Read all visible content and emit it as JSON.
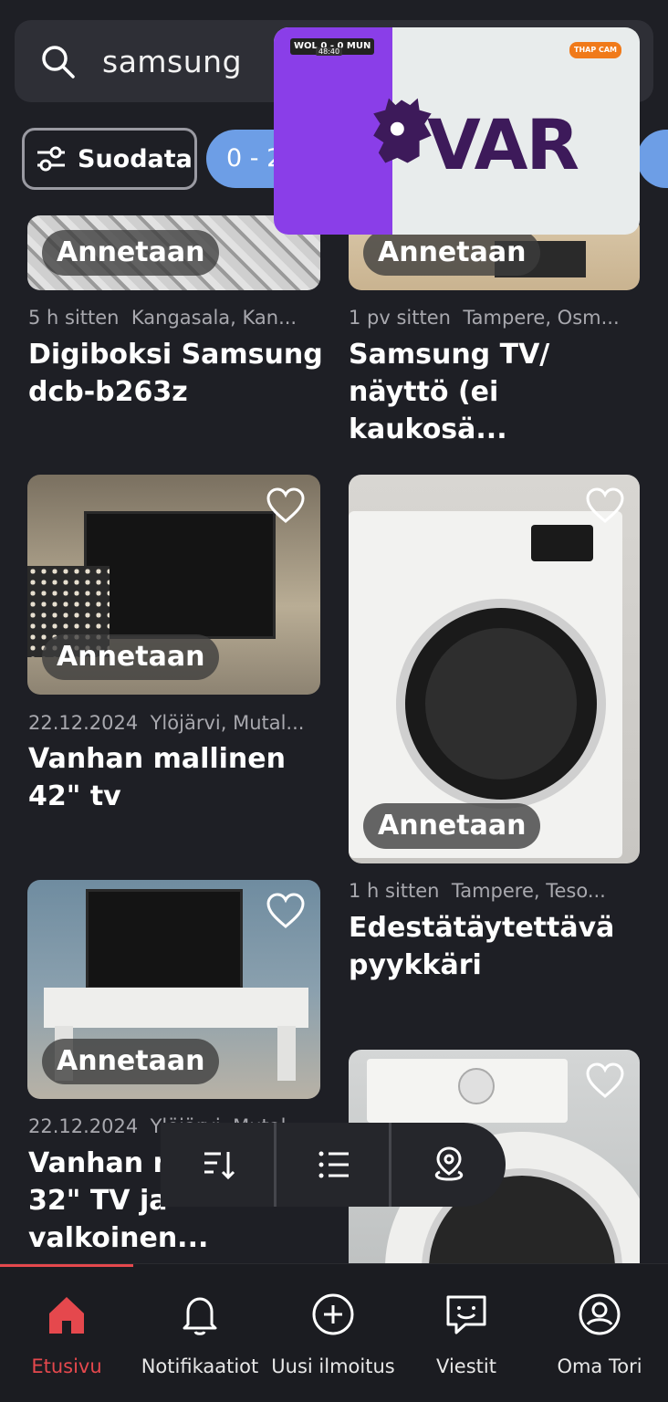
{
  "search": {
    "query": "samsung"
  },
  "filters": {
    "filter_label": "Suodata",
    "price_chip": "0 - 2"
  },
  "badge_label": "Annetaan",
  "listings": [
    {
      "time": "5 h sitten",
      "location": "Kangasala, Kan...",
      "title": "Digiboksi Samsung dcb-b263z"
    },
    {
      "time": "1 pv sitten",
      "location": "Tampere, Osm...",
      "title": "Samsung TV/ näyttö (ei kaukosä..."
    },
    {
      "time": "22.12.2024",
      "location": "Ylöjärvi, Mutal...",
      "title": "Vanhan mallinen 42\" tv"
    },
    {
      "time": "1 h sitten",
      "location": "Tampere, Teso...",
      "title": "Edestätäytettävä pyykkäri"
    },
    {
      "time": "22.12.2024",
      "location": "Ylöjärvi, Mutal...",
      "title": "Vanhan mallinen 32\" TV ja valkoinen..."
    }
  ],
  "pip": {
    "score": "WOL 0 - 0 MUN",
    "clock": "48:40",
    "brand": "THAP CAM",
    "overlay_text": "VAR"
  },
  "nav": {
    "items": [
      {
        "label": "Etusivu",
        "icon": "home-icon",
        "active": true
      },
      {
        "label": "Notifikaatiot",
        "icon": "bell-icon"
      },
      {
        "label": "Uusi ilmoitus",
        "icon": "plus-circle-icon"
      },
      {
        "label": "Viestit",
        "icon": "chat-icon"
      },
      {
        "label": "Oma Tori",
        "icon": "profile-icon"
      }
    ]
  },
  "colors": {
    "accent": "#e5484d",
    "chip": "#6d9ee6",
    "background": "#1e1f25"
  }
}
